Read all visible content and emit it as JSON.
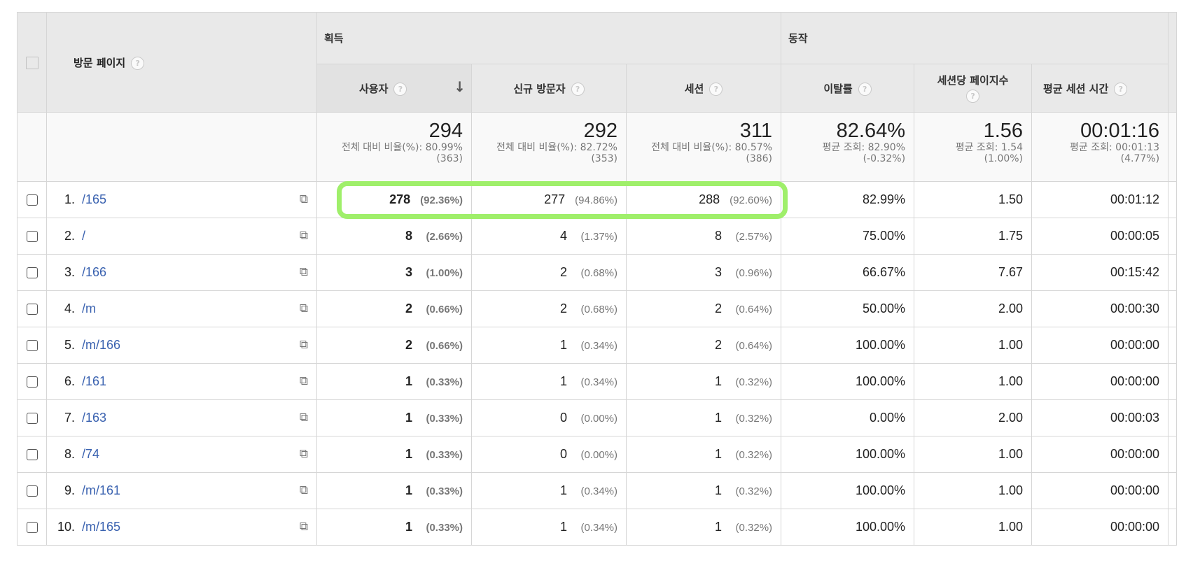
{
  "header": {
    "landing_page": "방문 페이지",
    "group_acquisition": "획득",
    "group_behavior": "동작",
    "columns": [
      "사용자",
      "신규 방문자",
      "세션",
      "이탈률",
      "세션당 페이지수",
      "평균 세션 시간"
    ],
    "sort_icon": "arrow-down-icon",
    "help_icon": "question-icon",
    "help_glyph": "?",
    "sort_glyph": "↓",
    "popout_glyph": "⧉"
  },
  "totals": [
    {
      "big": "294",
      "line1": "전체 대비 비율(%): 80.99%",
      "line2": "(363)"
    },
    {
      "big": "292",
      "line1": "전체 대비 비율(%): 82.72%",
      "line2": "(353)"
    },
    {
      "big": "311",
      "line1": "전체 대비 비율(%): 80.57%",
      "line2": "(386)"
    },
    {
      "big": "82.64%",
      "line1": "평균 조회: 82.90%",
      "line2": "(-0.32%)"
    },
    {
      "big": "1.56",
      "line1": "평균 조회: 1.54",
      "line2": "(1.00%)"
    },
    {
      "big": "00:01:16",
      "line1": "평균 조회: 00:01:13",
      "line2": "(4.77%)"
    }
  ],
  "rows": [
    {
      "rank": "1.",
      "page": "/165",
      "users": "278",
      "users_pct": "(92.36%)",
      "new": "277",
      "new_pct": "(94.86%)",
      "sessions": "288",
      "sessions_pct": "(92.60%)",
      "bounce": "82.99%",
      "pps": "1.50",
      "dur": "00:01:12"
    },
    {
      "rank": "2.",
      "page": "/",
      "users": "8",
      "users_pct": "(2.66%)",
      "new": "4",
      "new_pct": "(1.37%)",
      "sessions": "8",
      "sessions_pct": "(2.57%)",
      "bounce": "75.00%",
      "pps": "1.75",
      "dur": "00:00:05"
    },
    {
      "rank": "3.",
      "page": "/166",
      "users": "3",
      "users_pct": "(1.00%)",
      "new": "2",
      "new_pct": "(0.68%)",
      "sessions": "3",
      "sessions_pct": "(0.96%)",
      "bounce": "66.67%",
      "pps": "7.67",
      "dur": "00:15:42"
    },
    {
      "rank": "4.",
      "page": "/m",
      "users": "2",
      "users_pct": "(0.66%)",
      "new": "2",
      "new_pct": "(0.68%)",
      "sessions": "2",
      "sessions_pct": "(0.64%)",
      "bounce": "50.00%",
      "pps": "2.00",
      "dur": "00:00:30"
    },
    {
      "rank": "5.",
      "page": "/m/166",
      "users": "2",
      "users_pct": "(0.66%)",
      "new": "1",
      "new_pct": "(0.34%)",
      "sessions": "2",
      "sessions_pct": "(0.64%)",
      "bounce": "100.00%",
      "pps": "1.00",
      "dur": "00:00:00"
    },
    {
      "rank": "6.",
      "page": "/161",
      "users": "1",
      "users_pct": "(0.33%)",
      "new": "1",
      "new_pct": "(0.34%)",
      "sessions": "1",
      "sessions_pct": "(0.32%)",
      "bounce": "100.00%",
      "pps": "1.00",
      "dur": "00:00:00"
    },
    {
      "rank": "7.",
      "page": "/163",
      "users": "1",
      "users_pct": "(0.33%)",
      "new": "0",
      "new_pct": "(0.00%)",
      "sessions": "1",
      "sessions_pct": "(0.32%)",
      "bounce": "0.00%",
      "pps": "2.00",
      "dur": "00:00:03"
    },
    {
      "rank": "8.",
      "page": "/74",
      "users": "1",
      "users_pct": "(0.33%)",
      "new": "0",
      "new_pct": "(0.00%)",
      "sessions": "1",
      "sessions_pct": "(0.32%)",
      "bounce": "100.00%",
      "pps": "1.00",
      "dur": "00:00:00"
    },
    {
      "rank": "9.",
      "page": "/m/161",
      "users": "1",
      "users_pct": "(0.33%)",
      "new": "1",
      "new_pct": "(0.34%)",
      "sessions": "1",
      "sessions_pct": "(0.32%)",
      "bounce": "100.00%",
      "pps": "1.00",
      "dur": "00:00:00"
    },
    {
      "rank": "10.",
      "page": "/m/165",
      "users": "1",
      "users_pct": "(0.33%)",
      "new": "1",
      "new_pct": "(0.34%)",
      "sessions": "1",
      "sessions_pct": "(0.32%)",
      "bounce": "100.00%",
      "pps": "1.00",
      "dur": "00:00:00"
    }
  ],
  "colors": {
    "highlight": "#9fef6a",
    "link": "#3a62b0",
    "header_bg": "#e9e9e9"
  }
}
